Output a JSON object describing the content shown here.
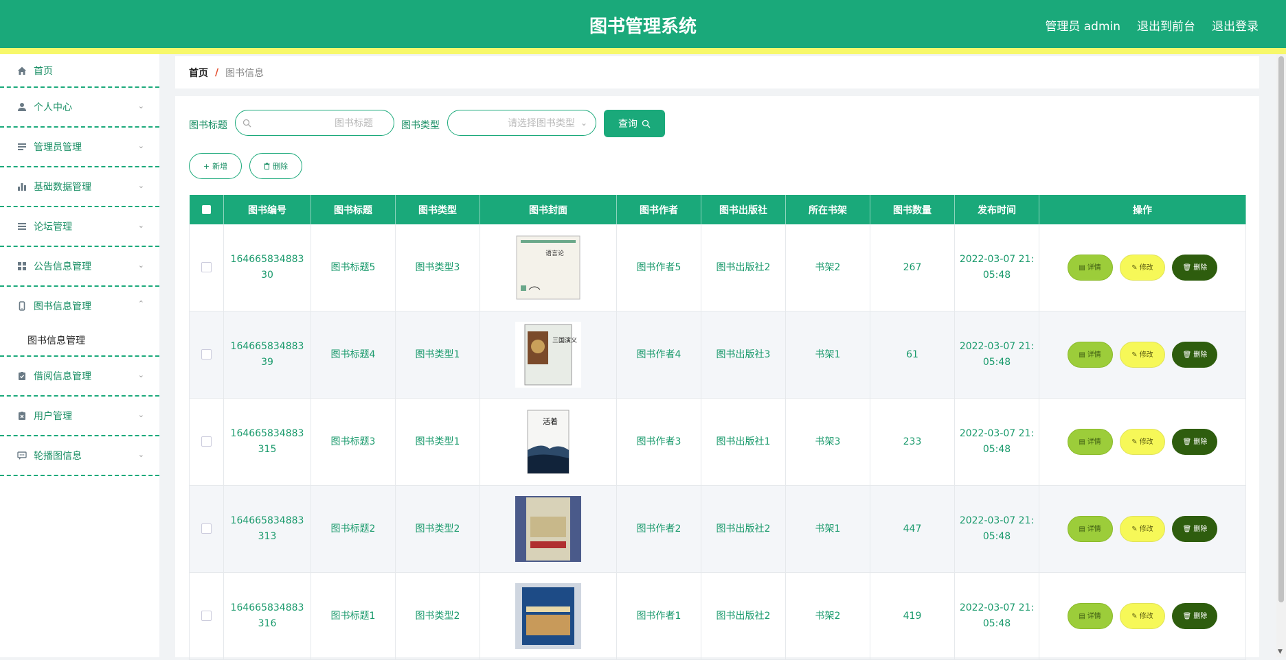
{
  "header": {
    "title": "图书管理系统",
    "links": [
      "管理员 admin",
      "退出到前台",
      "退出登录"
    ]
  },
  "sidebar": {
    "items": [
      {
        "label": "首页",
        "icon": "home-icon",
        "has_children": false
      },
      {
        "label": "个人中心",
        "icon": "user-icon",
        "has_children": true
      },
      {
        "label": "管理员管理",
        "icon": "list-icon",
        "has_children": true
      },
      {
        "label": "基础数据管理",
        "icon": "bar-chart-icon",
        "has_children": true
      },
      {
        "label": "论坛管理",
        "icon": "menu-icon",
        "has_children": true
      },
      {
        "label": "公告信息管理",
        "icon": "grid-icon",
        "has_children": true
      },
      {
        "label": "图书信息管理",
        "icon": "phone-icon",
        "has_children": true,
        "expanded": true
      },
      {
        "label": "借阅信息管理",
        "icon": "clipboard-check-icon",
        "has_children": true
      },
      {
        "label": "用户管理",
        "icon": "clipboard-x-icon",
        "has_children": true
      },
      {
        "label": "轮播图信息",
        "icon": "chat-icon",
        "has_children": true
      }
    ],
    "submenu_item": "图书信息管理"
  },
  "breadcrumb": {
    "home": "首页",
    "separator": "/",
    "current": "图书信息"
  },
  "search": {
    "title_label": "图书标题",
    "title_placeholder": "图书标题",
    "type_label": "图书类型",
    "type_placeholder": "请选择图书类型",
    "query_button": "查询"
  },
  "actions": {
    "add": "新增",
    "delete": "删除"
  },
  "table": {
    "headers": [
      "图书编号",
      "图书标题",
      "图书类型",
      "图书封面",
      "图书作者",
      "图书出版社",
      "所在书架",
      "图书数量",
      "发布时间",
      "操作"
    ],
    "row_buttons": {
      "detail": "详情",
      "edit": "修改",
      "delete": "删除"
    },
    "rows": [
      {
        "id_line1": "164665834883",
        "id_line2": "30",
        "title": "图书标题5",
        "type": "图书类型3",
        "author": "图书作者5",
        "publisher": "图书出版社2",
        "shelf": "书架2",
        "count": "267",
        "time_line1": "2022-03-07 21:",
        "time_line2": "05:48",
        "cover_text": "语言论"
      },
      {
        "id_line1": "164665834883",
        "id_line2": "39",
        "title": "图书标题4",
        "type": "图书类型1",
        "author": "图书作者4",
        "publisher": "图书出版社3",
        "shelf": "书架1",
        "count": "61",
        "time_line1": "2022-03-07 21:",
        "time_line2": "05:48",
        "cover_text": "三国演义"
      },
      {
        "id_line1": "164665834883",
        "id_line2": "315",
        "title": "图书标题3",
        "type": "图书类型1",
        "author": "图书作者3",
        "publisher": "图书出版社1",
        "shelf": "书架3",
        "count": "233",
        "time_line1": "2022-03-07 21:",
        "time_line2": "05:48",
        "cover_text": "活着"
      },
      {
        "id_line1": "164665834883",
        "id_line2": "313",
        "title": "图书标题2",
        "type": "图书类型2",
        "author": "图书作者2",
        "publisher": "图书出版社2",
        "shelf": "书架1",
        "count": "447",
        "time_line1": "2022-03-07 21:",
        "time_line2": "05:48",
        "cover_text": ""
      },
      {
        "id_line1": "164665834883",
        "id_line2": "316",
        "title": "图书标题1",
        "type": "图书类型2",
        "author": "图书作者1",
        "publisher": "图书出版社2",
        "shelf": "书架2",
        "count": "419",
        "time_line1": "2022-03-07 21:",
        "time_line2": "05:48",
        "cover_text": ""
      }
    ]
  },
  "colors": {
    "primary": "#1aa97a",
    "accent_stripe": "#f7f86a",
    "detail": "#9ccd3a",
    "edit": "#f6f858",
    "delete": "#2e5d0e"
  }
}
